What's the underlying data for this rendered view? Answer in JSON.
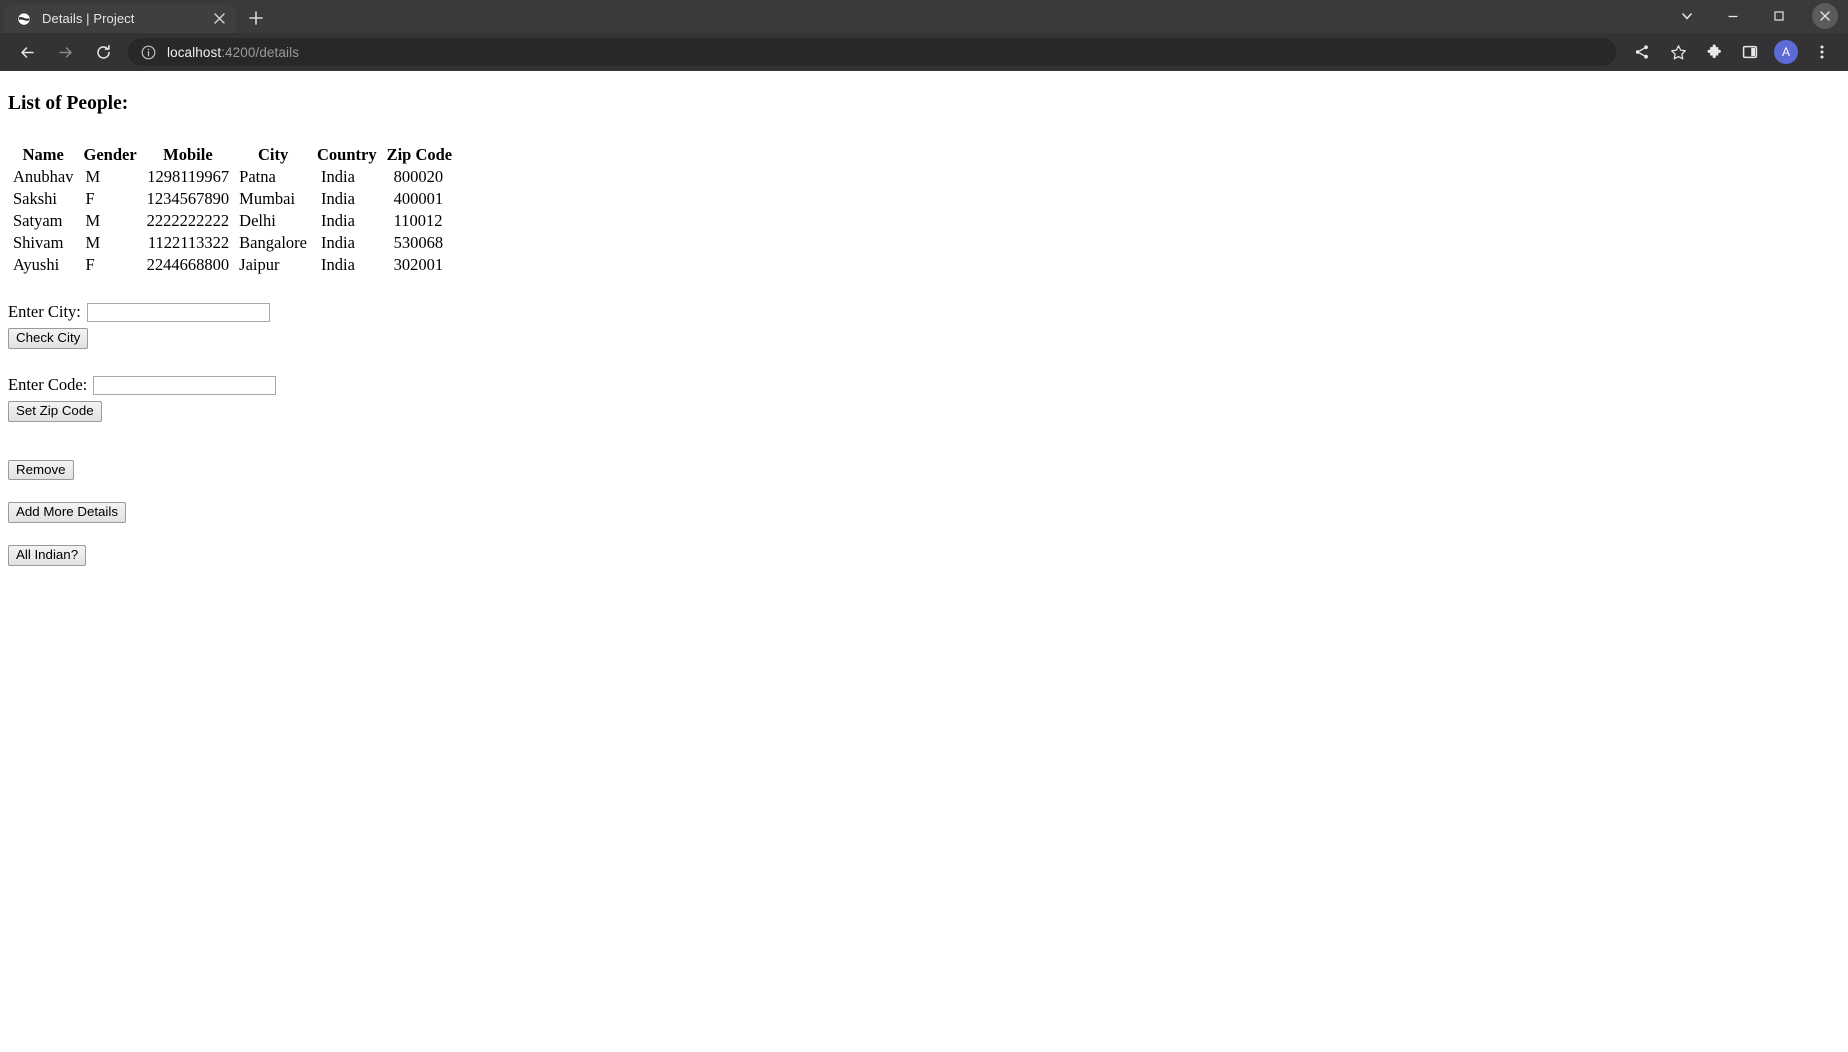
{
  "browser": {
    "tab": {
      "title": "Details | Project",
      "favicon_icon": "globe-favicon",
      "close_icon": "close-icon"
    },
    "new_tab_icon": "plus-icon",
    "window_controls": {
      "list_tabs_icon": "chevron-down-icon",
      "minimize_icon": "minimize-icon",
      "maximize_icon": "maximize-icon",
      "close_icon": "window-close-icon"
    },
    "toolbar": {
      "back_icon": "back-arrow-icon",
      "forward_icon": "forward-arrow-icon",
      "reload_icon": "reload-icon",
      "site_info_icon": "info-circle-icon",
      "url_host": "localhost",
      "url_path": ":4200/details",
      "share_icon": "share-icon",
      "bookmark_icon": "star-icon",
      "extensions_icon": "puzzle-icon",
      "side_panel_icon": "side-panel-icon",
      "avatar_initial": "A",
      "menu_icon": "three-dot-menu-icon"
    },
    "colors": {
      "tabstrip_bg": "#3a3a3c",
      "toolbar_bg": "#333335",
      "omnibox_bg": "#28282a",
      "avatar_bg": "#5c6bd6",
      "page_bg": "#ffffff"
    }
  },
  "page": {
    "heading": "List of People:",
    "table": {
      "headers": [
        "Name",
        "Gender",
        "Mobile",
        "City",
        "Country",
        "Zip Code"
      ],
      "rows": [
        {
          "name": "Anubhav",
          "gender": "M",
          "mobile": "1298119967",
          "city": "Patna",
          "country": "India",
          "zip": "800020"
        },
        {
          "name": "Sakshi",
          "gender": "F",
          "mobile": "1234567890",
          "city": "Mumbai",
          "country": "India",
          "zip": "400001"
        },
        {
          "name": "Satyam",
          "gender": "M",
          "mobile": "2222222222",
          "city": "Delhi",
          "country": "India",
          "zip": "110012"
        },
        {
          "name": "Shivam",
          "gender": "M",
          "mobile": "1122113322",
          "city": "Bangalore",
          "country": "India",
          "zip": "530068"
        },
        {
          "name": "Ayushi",
          "gender": "F",
          "mobile": "2244668800",
          "city": "Jaipur",
          "country": "India",
          "zip": "302001"
        }
      ]
    },
    "city_form": {
      "label": "Enter City:",
      "input_value": "",
      "input_placeholder": "",
      "button_label": "Check City"
    },
    "code_form": {
      "label": "Enter Code:",
      "input_value": "",
      "input_placeholder": "",
      "button_label": "Set Zip Code"
    },
    "actions": {
      "remove_label": "Remove",
      "add_more_label": "Add More Details",
      "all_indian_label": "All Indian?"
    }
  }
}
